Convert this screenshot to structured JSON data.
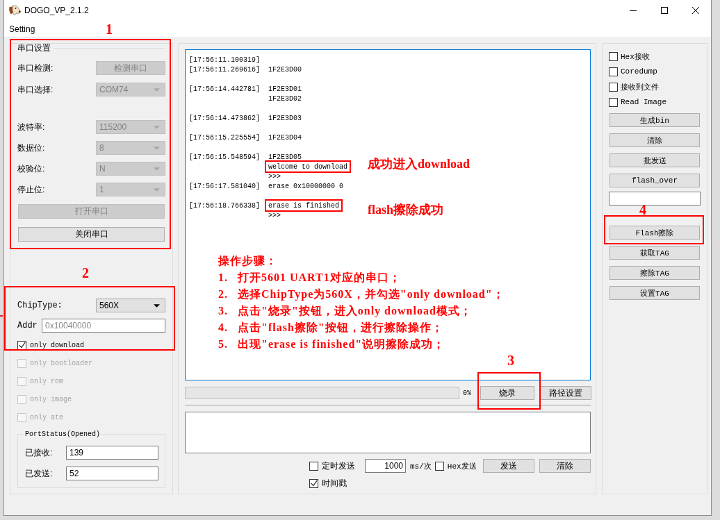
{
  "window": {
    "title": "DOGO_VP_2.1.2"
  },
  "menu": [
    {
      "label": "Setting"
    }
  ],
  "serial_settings": {
    "title": "串口设置",
    "rows": [
      {
        "kind": "button",
        "label": "串口检测:",
        "value": "检测串口",
        "disabled": true
      },
      {
        "kind": "select",
        "label": "串口选择:",
        "value": "COM74",
        "disabled": true
      },
      {
        "kind": "select",
        "label": "波特率:",
        "value": "115200",
        "disabled": true
      },
      {
        "kind": "select",
        "label": "数据位:",
        "value": "8",
        "disabled": true
      },
      {
        "kind": "select",
        "label": "校验位:",
        "value": "N",
        "disabled": true
      },
      {
        "kind": "select",
        "label": "停止位:",
        "value": "1",
        "disabled": true
      }
    ],
    "buttons": [
      {
        "label": "打开串口",
        "disabled": true
      },
      {
        "label": "关闭串口",
        "disabled": false
      }
    ]
  },
  "chip": {
    "label": "ChipType:",
    "value": "560X",
    "addr_label": "Addr",
    "addr_placeholder": "0x10040000"
  },
  "options": [
    {
      "label": "only download",
      "checked": true,
      "disabled": false
    },
    {
      "label": "only bootloader",
      "checked": false,
      "disabled": true
    },
    {
      "label": "only rom",
      "checked": false,
      "disabled": true
    },
    {
      "label": "only image",
      "checked": false,
      "disabled": true
    },
    {
      "label": "only ate",
      "checked": false,
      "disabled": true
    }
  ],
  "port_status": {
    "title": "PortStatus(Opened)",
    "fields": [
      {
        "label": "已接收:",
        "value": "139"
      },
      {
        "label": "已发送:",
        "value": "52"
      }
    ]
  },
  "log": {
    "lines": [
      {
        "kind": "stamped",
        "timestamp": "[17:56:11.100319]"
      },
      {
        "kind": "stamped",
        "timestamp": "[17:56:11.269616]",
        "text": "1F2E3D00"
      },
      {
        "kind": "blank"
      },
      {
        "kind": "stamped",
        "timestamp": "[17:56:14.442781]",
        "text": "1F2E3D01"
      },
      {
        "kind": "continued",
        "text": "1F2E3D02"
      },
      {
        "kind": "blank"
      },
      {
        "kind": "stamped",
        "timestamp": "[17:56:14.473862]",
        "text": "1F2E3D03"
      },
      {
        "kind": "blank"
      },
      {
        "kind": "stamped",
        "timestamp": "[17:56:15.225554]",
        "text": "1F2E3D04"
      },
      {
        "kind": "blank"
      },
      {
        "kind": "stamped",
        "timestamp": "[17:56:15.548594]",
        "text": "1F2E3D05"
      },
      {
        "kind": "continued",
        "text": "welcome to download",
        "note": "成功进入download"
      },
      {
        "kind": "continued",
        "text": ">>>"
      },
      {
        "kind": "stamped",
        "timestamp": "[17:56:17.581040]",
        "text": "erase 0x10000000 0"
      },
      {
        "kind": "blank"
      },
      {
        "kind": "stamped",
        "timestamp": "[17:56:18.766338]",
        "text": "erase is finished",
        "note": "flash擦除成功"
      },
      {
        "kind": "continued",
        "text": ">>>"
      }
    ]
  },
  "steps": {
    "title": "操作步骤：",
    "items": [
      {
        "number": "1.",
        "text": "打开5601 UART1对应的串口；"
      },
      {
        "number": "2.",
        "text": "选择ChipType为560X，并勾选\"only download\"；"
      },
      {
        "number": "3.",
        "text": "点击\"烧录\"按钮，进入only download模式；"
      },
      {
        "number": "4.",
        "text": "点击\"flash擦除\"按钮，进行擦除操作；"
      },
      {
        "number": "5.",
        "text": "出现\"erase is finished\"说明擦除成功；"
      }
    ]
  },
  "progress": {
    "level": 0,
    "reading": "0%"
  },
  "burn_buttons": [
    {
      "label": "烧录"
    },
    {
      "label": "路径设置"
    }
  ],
  "send": {
    "timed": {
      "label": "定时发送",
      "checked": false
    },
    "interval": "1000",
    "unit": "ms/次",
    "hex": {
      "label": "Hex发送",
      "checked": false
    },
    "buttons": [
      {
        "label": "发送"
      },
      {
        "label": "清除"
      }
    ],
    "timestamp": {
      "label": "时间戳",
      "checked": true
    }
  },
  "right_panel": {
    "options": [
      {
        "label": "Hex接收",
        "checked": false
      },
      {
        "label": "Coredump",
        "checked": false
      },
      {
        "label": "接收到文件",
        "checked": false
      },
      {
        "label": "Read Image",
        "checked": false
      }
    ],
    "items": [
      {
        "kind": "button",
        "label": "生成bin"
      },
      {
        "kind": "button",
        "label": "清除"
      },
      {
        "kind": "button",
        "label": "批发送"
      },
      {
        "kind": "button",
        "label": "flash_over"
      },
      {
        "kind": "input"
      },
      {
        "kind": "button",
        "label": "Flash擦除"
      },
      {
        "kind": "button",
        "label": "获取TAG"
      },
      {
        "kind": "button",
        "label": "擦除TAG"
      },
      {
        "kind": "button",
        "label": "设置TAG"
      }
    ]
  },
  "annotations": [
    {
      "number": "1"
    },
    {
      "number": "2"
    },
    {
      "number": "3"
    },
    {
      "number": "4"
    }
  ]
}
